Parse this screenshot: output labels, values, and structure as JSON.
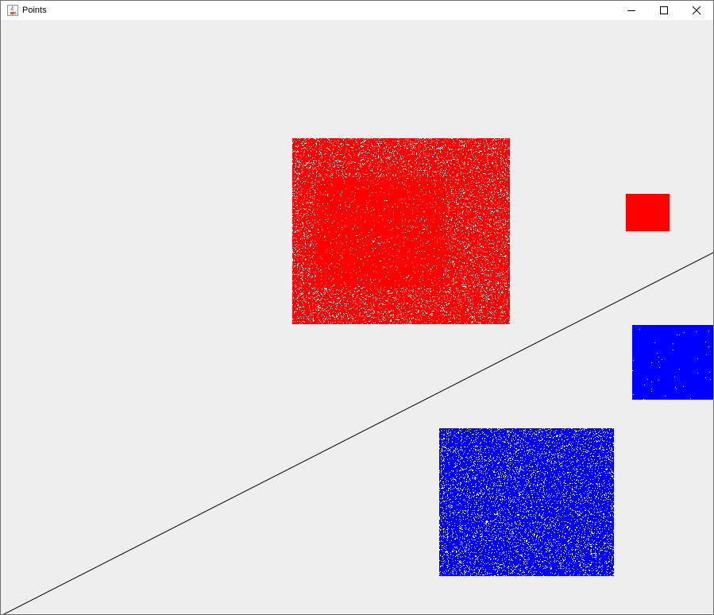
{
  "window": {
    "title": "Points",
    "icon": "java-coffee-cup-icon",
    "controls": {
      "minimize_icon": "minimize-icon",
      "maximize_icon": "maximize-icon",
      "close_icon": "close-icon"
    }
  },
  "canvas": {
    "background": "#eeeeee",
    "line_color": "#000000",
    "colors": {
      "red": "#ff0000",
      "blue": "#0000ff"
    }
  }
}
